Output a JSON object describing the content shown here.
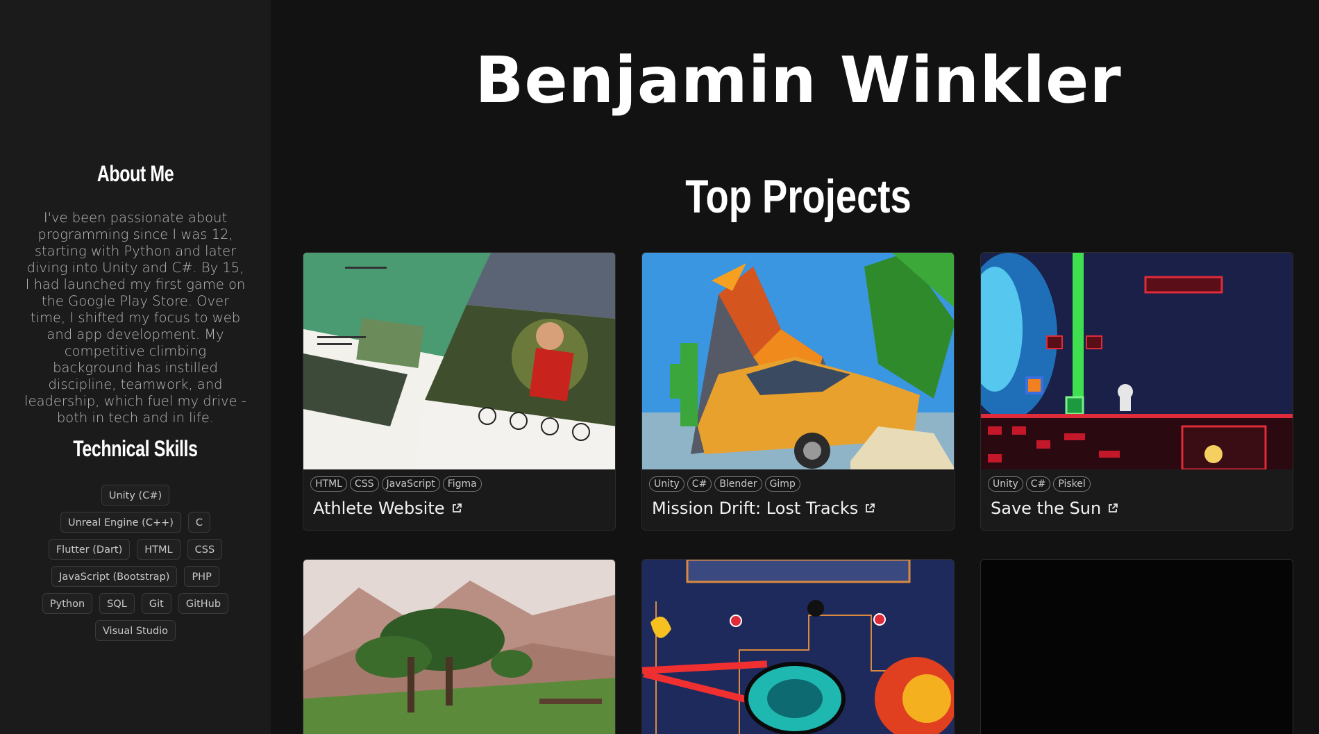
{
  "sidebar": {
    "about_title": "About Me",
    "about_text": "I've been passionate about programming since I was 12, starting with Python and later diving into Unity and C#. By 15, I had launched my first game on the Google Play Store. Over time, I shifted my focus to web and app development. My competitive climbing background has instilled discipline, teamwork, and leadership, which fuel my drive - both in tech and in life.",
    "skills_title": "Technical Skills",
    "skills": [
      "Unity (C#)",
      "Unreal Engine (C++)",
      "C",
      "Flutter (Dart)",
      "HTML",
      "CSS",
      "JavaScript (Bootstrap)",
      "PHP",
      "Python",
      "SQL",
      "Git",
      "GitHub",
      "Visual Studio"
    ]
  },
  "header": {
    "title": "Benjamin Winkler"
  },
  "projects": {
    "section_title": "Top Projects",
    "cards": [
      {
        "title": "Athlete Website",
        "tags": [
          "HTML",
          "CSS",
          "JavaScript",
          "Figma"
        ],
        "link_icon": "external-link-icon"
      },
      {
        "title": "Mission Drift: Lost Tracks",
        "tags": [
          "Unity",
          "C#",
          "Blender",
          "Gimp"
        ],
        "link_icon": "external-link-icon"
      },
      {
        "title": "Save the Sun",
        "tags": [
          "Unity",
          "C#",
          "Piskel"
        ],
        "link_icon": "external-link-icon"
      }
    ]
  },
  "colors": {
    "background": "#121212",
    "sidebar": "#1b1b1b",
    "card": "#1a1a1a"
  }
}
